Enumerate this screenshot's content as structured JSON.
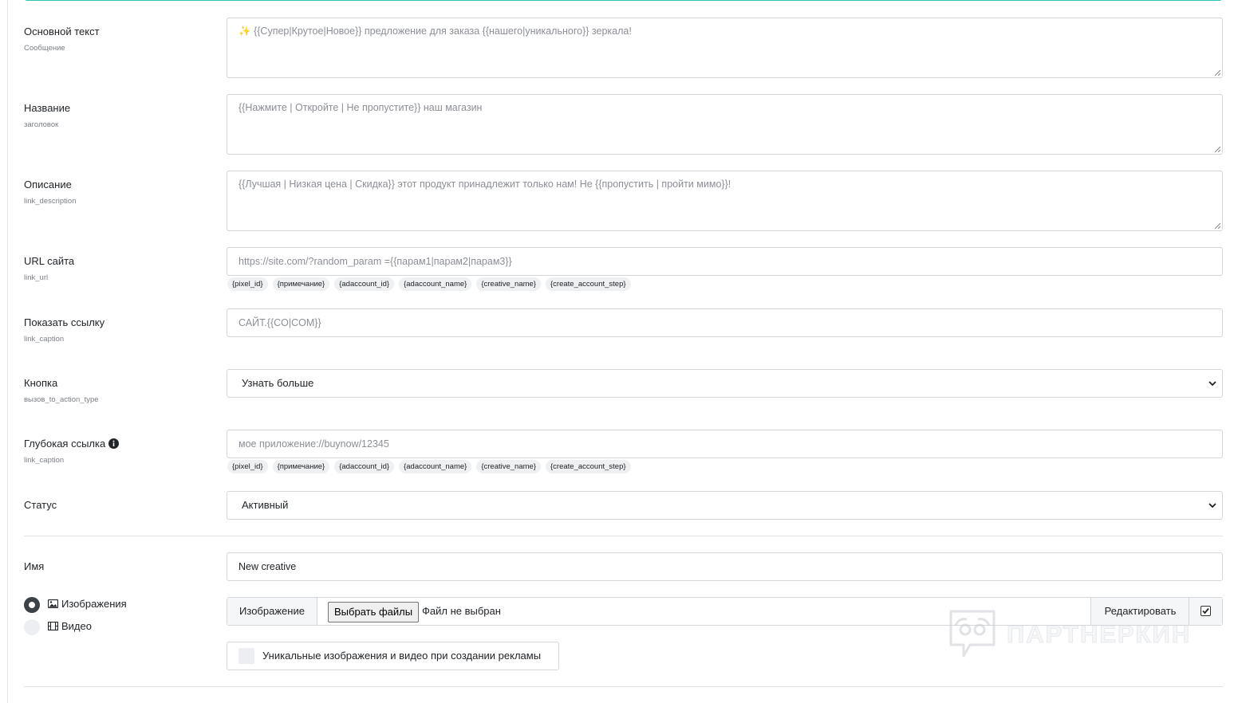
{
  "fields": {
    "message": {
      "label": "Основной текст",
      "sub": "Сообщение",
      "emoji": "✨",
      "value": "{{Супер|Крутое|Новое}} предложение для заказа {{нашего|уникального}} зеркала!"
    },
    "title": {
      "label": "Название",
      "sub": "заголовок",
      "value": "{{Нажмите | Откройте | Не пропустите}} наш магазин"
    },
    "description": {
      "label": "Описание",
      "sub": "link_description",
      "value": "{{Лучшая | Низкая цена | Скидка}} этот продукт принадлежит только нам! Не {{пропустить | пройти мимо}}!"
    },
    "url": {
      "label": "URL сайта",
      "sub": "link_url",
      "placeholder": "https://site.com/?random_param ={{парам1|парам2|парам3}}"
    },
    "caption": {
      "label": "Показать ссылку",
      "sub": "link_caption",
      "placeholder": "САЙТ.{{CO|COM}}"
    },
    "button": {
      "label": "Кнопка",
      "sub": "вызов_to_action_type",
      "selected": "Узнать больше"
    },
    "deeplink": {
      "label": "Глубокая ссылка",
      "sub": "link_caption",
      "placeholder": "мое приложение://buynow/12345"
    },
    "status": {
      "label": "Статус",
      "selected": "Активный"
    },
    "name": {
      "label": "Имя",
      "value": "New creative"
    }
  },
  "macro_tags": [
    "{pixel_id}",
    "{примечание}",
    "{adaccount_id}",
    "{adaccount_name}",
    "{creative_name}",
    "{create_account_step}"
  ],
  "media": {
    "images_label": "Изображения",
    "video_label": "Видео",
    "selected": "images",
    "prefix": "Изображение",
    "choose_button": "Выбрать файлы",
    "file_status": "Файл не выбран",
    "edit_button": "Редактировать",
    "edit_checked": true,
    "unique_label": "Уникальные изображения и видео при создании рекламы",
    "unique_checked": false
  },
  "watermark": "ПАРТНЕРКИН",
  "colors": {
    "accent": "#2ec4b6",
    "border": "#d3d6da",
    "tag_bg": "#eef0f2",
    "radio_on": "#3d4246"
  }
}
